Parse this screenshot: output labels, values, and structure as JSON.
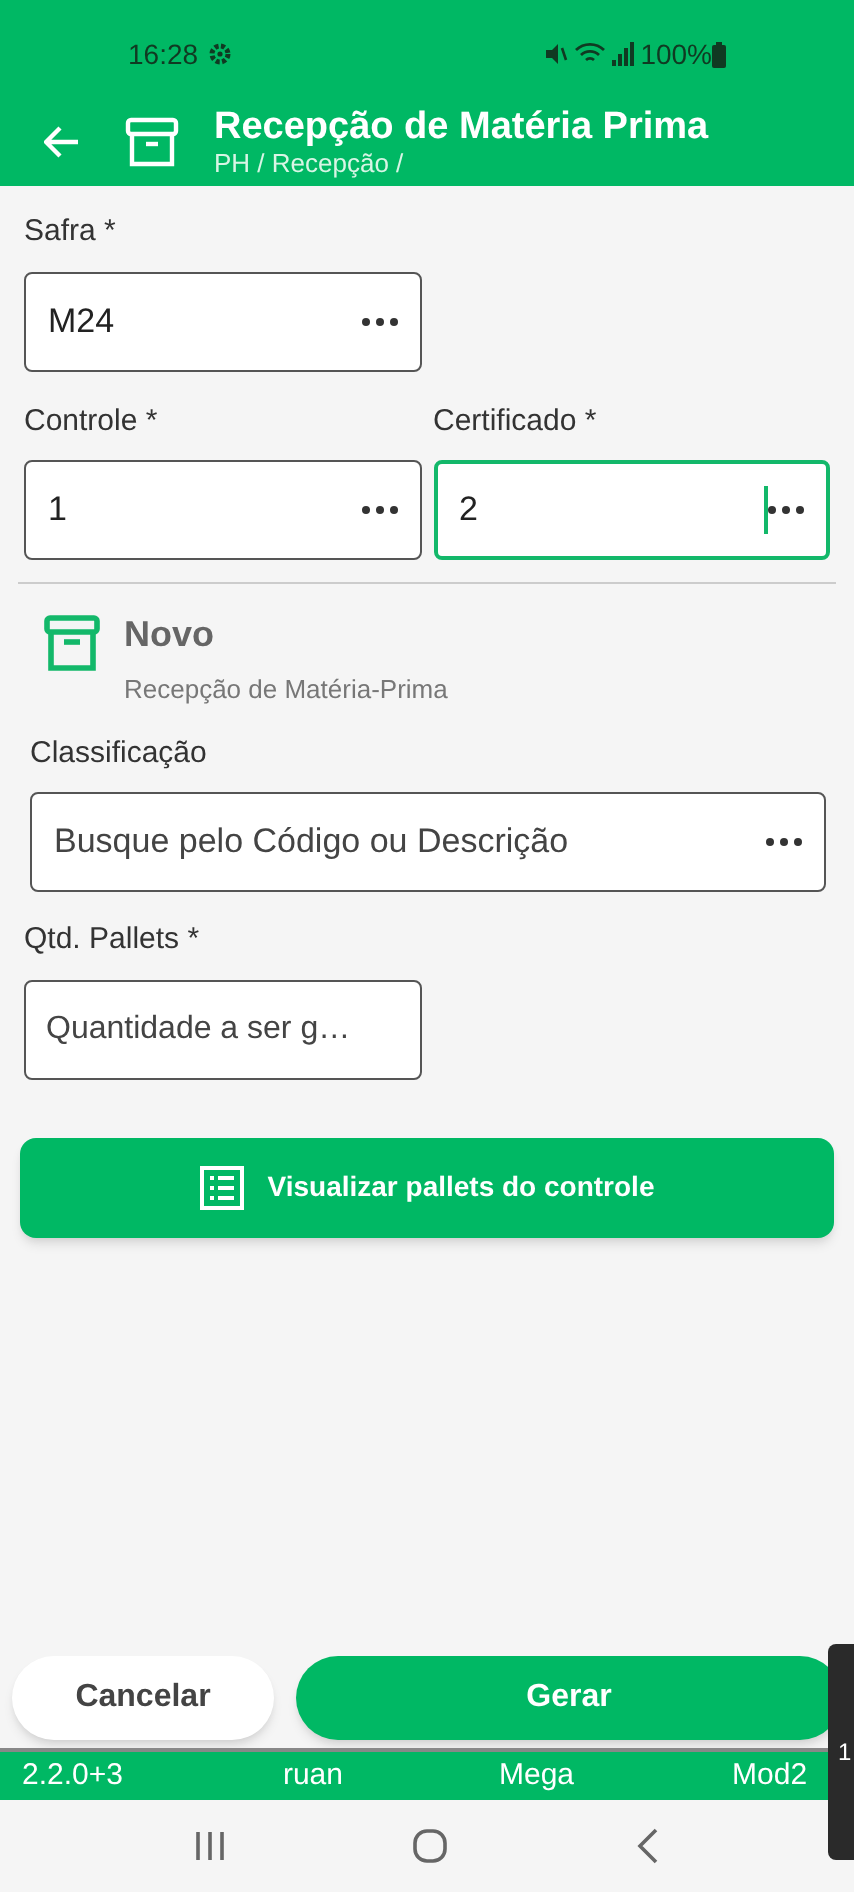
{
  "status_bar": {
    "time": "16:28",
    "battery": "100%"
  },
  "app_bar": {
    "title": "Recepção de Matéria Prima",
    "breadcrumb": "PH / Recepção /"
  },
  "fields_top": [
    {
      "label": "Safra *",
      "value": "M24",
      "focused": false
    }
  ],
  "fields_row": [
    {
      "label": "Controle *",
      "value": "1",
      "focused": false
    },
    {
      "label": "Certificado *",
      "value": "2",
      "focused": true
    }
  ],
  "section": {
    "title": "Novo",
    "subtitle": "Recepção de Matéria-Prima"
  },
  "classificacao": {
    "label": "Classificação",
    "placeholder": "Busque pelo Código ou Descrição"
  },
  "qtd": {
    "label": "Qtd. Pallets *",
    "placeholder": "Quantidade a ser g…"
  },
  "view_button": "Visualizar pallets do controle",
  "actions": {
    "cancel": "Cancelar",
    "confirm": "Gerar"
  },
  "info_strip": [
    "2.2.0+3",
    "ruan",
    "Mega",
    "Mod2"
  ],
  "overlay": {
    "text": "1"
  }
}
